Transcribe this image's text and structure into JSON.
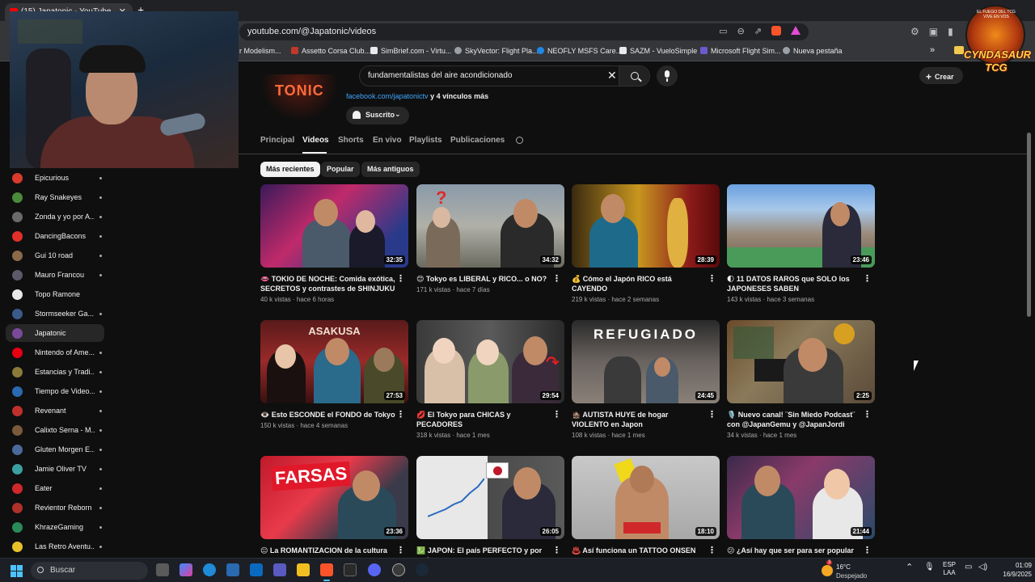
{
  "browser": {
    "tab_title": "(15) Japatonic - YouTube",
    "url": "youtube.com/@Japatonic/videos",
    "bookmarks": [
      {
        "label": "r Modelism...",
        "color": "#6c6c6c"
      },
      {
        "label": "Assetto Corsa Club...",
        "color": "#c0392b"
      },
      {
        "label": "SimBrief.com - Virtu...",
        "color": "#e8eaed"
      },
      {
        "label": "SkyVector: Flight Pla...",
        "color": "#9aa0a6"
      },
      {
        "label": "NEOFLY MSFS Care...",
        "color": "#1e88e5"
      },
      {
        "label": "SAZM - VueloSimple",
        "color": "#e8eaed"
      },
      {
        "label": "Microsoft Flight Sim...",
        "color": "#6a5acd"
      },
      {
        "label": "Nueva pestaña",
        "color": "#9aa0a6"
      }
    ],
    "more_bookmarks": "»"
  },
  "youtube": {
    "search_value": "fundamentalistas del aire acondicionado",
    "create_label": "Crear",
    "channel": {
      "logo_text": "TONIC",
      "link": "facebook.com/japatonictv",
      "more_links": "y 4 vínculos más",
      "subscribed_label": "Suscrito"
    },
    "tabs": [
      "Principal",
      "Videos",
      "Shorts",
      "En vivo",
      "Playlists",
      "Publicaciones"
    ],
    "active_tab": "Videos",
    "chips": [
      "Más recientes",
      "Popular",
      "Más antiguos"
    ],
    "videos": [
      {
        "title": "👄 TOKIO DE NOCHE: Comida exótica, SECRETOS y contrastes de SHINJUKU",
        "views": "40 k vistas",
        "age": "hace 6 horas",
        "duration": "32:35"
      },
      {
        "title": "😊 Tokyo es LIBERAL y RICO... o NO?",
        "views": "171 k vistas",
        "age": "hace 7 días",
        "duration": "34:32"
      },
      {
        "title": "💰 Cómo el Japón RICO está CAYENDO",
        "views": "219 k vistas",
        "age": "hace 2 semanas",
        "duration": "28:39"
      },
      {
        "title": "🌓 11 DATOS RAROS que SOLO los JAPONESES SABEN",
        "views": "143 k vistas",
        "age": "hace 3 semanas",
        "duration": "23:46"
      },
      {
        "title": "👁️ Esto ESCONDE el FONDO de Tokyo",
        "views": "150 k vistas",
        "age": "hace 4 semanas",
        "duration": "27:53"
      },
      {
        "title": "💋 El Tokyo para CHICAS y PECADORES",
        "views": "318 k vistas",
        "age": "hace 1 mes",
        "duration": "29:54"
      },
      {
        "title": "🏚️ AUTISTA HUYE de hogar VIOLENTO en Japon",
        "views": "108 k vistas",
        "age": "hace 1 mes",
        "duration": "24:45"
      },
      {
        "title": "🎙️ Nuevo canal! ¨Sin Miedo Podcast¨ con @JapanGemu y @JapanJordi",
        "views": "34 k vistas",
        "age": "hace 1 mes",
        "duration": "2:25"
      },
      {
        "title": "😐 La ROMANTIZACION de la cultura",
        "views": "",
        "age": "",
        "duration": "23:36"
      },
      {
        "title": "💹 JAPON: El país PERFECTO y por qué",
        "views": "",
        "age": "",
        "duration": "26:05"
      },
      {
        "title": "♨️ Así funciona un TATTOO ONSEN por",
        "views": "",
        "age": "",
        "duration": "18:10"
      },
      {
        "title": "😕 ¿Así hay que ser para ser popular en",
        "views": "",
        "age": "",
        "duration": "21:44"
      }
    ],
    "thumb_texts": {
      "refugiado": "REFUGIADO",
      "farsas": "FARSAS",
      "asakusa": "ASAKUSA"
    }
  },
  "sidebar": {
    "items": [
      {
        "label": "Epicurious",
        "color": "#d93a2b"
      },
      {
        "label": "Ray Snakeyes",
        "color": "#4a8a3a"
      },
      {
        "label": "Zonda y yo por A...",
        "color": "#6a6a6a"
      },
      {
        "label": "DancingBacons",
        "color": "#e0302a"
      },
      {
        "label": "Gui 10 road",
        "color": "#8a6a4a"
      },
      {
        "label": "Mauro Francou",
        "color": "#5a5a6a"
      },
      {
        "label": "Topo Ramone",
        "color": "#e8e8e8"
      },
      {
        "label": "Stormseeker Ga...",
        "color": "#3a5a8a"
      },
      {
        "label": "Japatonic",
        "color": "#7a4a9a"
      },
      {
        "label": "Nintendo of Ame...",
        "color": "#e60012"
      },
      {
        "label": "Estancias y Tradi...",
        "color": "#8a7a3a"
      },
      {
        "label": "Tiempo de Video...",
        "color": "#2a6ab0"
      },
      {
        "label": "Revenant",
        "color": "#c0302a"
      },
      {
        "label": "Calixto Serna - M...",
        "color": "#7a5a3a"
      },
      {
        "label": "Gluten Morgen E...",
        "color": "#4a6a9a"
      },
      {
        "label": "Jamie Oliver TV",
        "color": "#3aa0a0"
      },
      {
        "label": "Eater",
        "color": "#d0282a"
      },
      {
        "label": "Revientor Reborn",
        "color": "#b0302a"
      },
      {
        "label": "KhrazeGaming",
        "color": "#2a8a5a"
      },
      {
        "label": "Las Retro Aventu...",
        "color": "#e8c02a"
      }
    ],
    "active_item": "Japatonic"
  },
  "overlay": {
    "logo_line1": "CYNDASAUR",
    "logo_line2": "TCG",
    "logo_small": "EL FUEGO DEL TCG VIVE EN VOS"
  },
  "taskbar": {
    "search_placeholder": "Buscar",
    "weather_temp": "16°C",
    "weather_desc": "Despejado",
    "lang_line1": "ESP",
    "lang_line2": "LAA",
    "time": "01:09",
    "date": "16/9/2025",
    "weather_badge": "3"
  }
}
